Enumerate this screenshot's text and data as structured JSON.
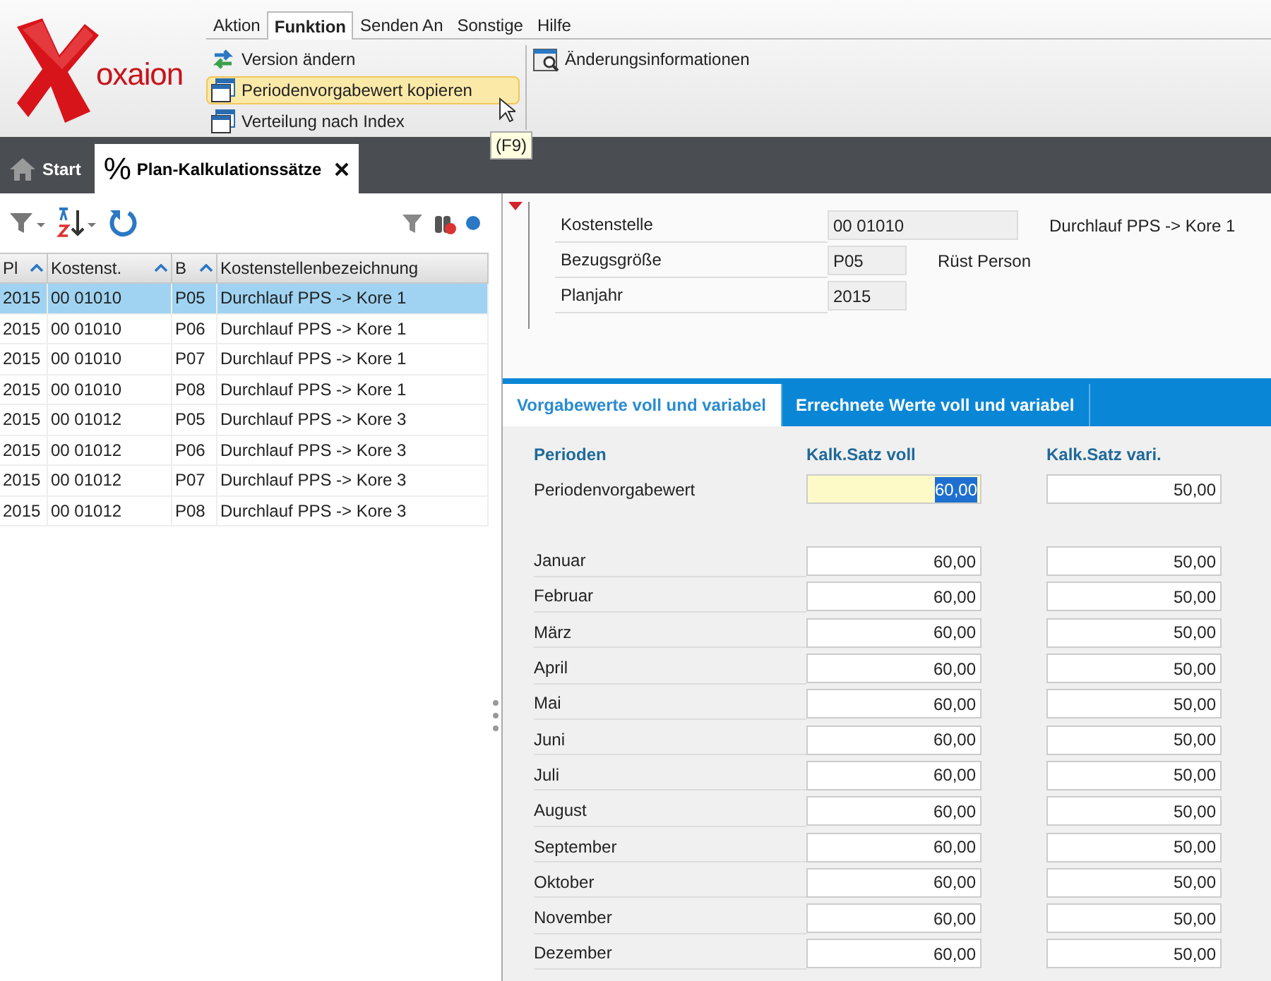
{
  "logo": {
    "text": "oxaion"
  },
  "menu": [
    {
      "label": "Aktion",
      "selected": false
    },
    {
      "label": "Funktion",
      "selected": true
    },
    {
      "label": "Senden An",
      "selected": false
    },
    {
      "label": "Sonstige",
      "selected": false
    },
    {
      "label": "Hilfe",
      "selected": false
    }
  ],
  "ribbon": [
    {
      "label": "Version ändern",
      "kind": "swap",
      "hovered": false
    },
    {
      "label": "Periodenvorgabewert kopieren",
      "kind": "window",
      "hovered": true
    },
    {
      "label": "Verteilung nach Index",
      "kind": "window",
      "hovered": false
    }
  ],
  "ribbon_right": [
    {
      "label": "Änderungsinformationen",
      "kind": "calendar"
    }
  ],
  "tooltip": "(F9)",
  "doc_tabs": [
    {
      "label": "Start",
      "kind": "home",
      "selected": false
    },
    {
      "label": "Plan-Kalkulationssätze",
      "kind": "symbol",
      "symbol": "%",
      "selected": true
    }
  ],
  "table": {
    "columns": [
      "Pl",
      "Kostenst.",
      "B",
      "Kostenstellenbezeichnung"
    ],
    "rows": [
      {
        "cells": [
          "2015",
          "00 01010",
          "P05",
          "Durchlauf PPS -> Kore 1"
        ],
        "selected": true
      },
      {
        "cells": [
          "2015",
          "00 01010",
          "P06",
          "Durchlauf PPS -> Kore 1"
        ],
        "selected": false
      },
      {
        "cells": [
          "2015",
          "00 01010",
          "P07",
          "Durchlauf PPS -> Kore 1"
        ],
        "selected": false
      },
      {
        "cells": [
          "2015",
          "00 01010",
          "P08",
          "Durchlauf PPS -> Kore 1"
        ],
        "selected": false
      },
      {
        "cells": [
          "2015",
          "00 01012",
          "P05",
          "Durchlauf PPS -> Kore 3"
        ],
        "selected": false
      },
      {
        "cells": [
          "2015",
          "00 01012",
          "P06",
          "Durchlauf PPS -> Kore 3"
        ],
        "selected": false
      },
      {
        "cells": [
          "2015",
          "00 01012",
          "P07",
          "Durchlauf PPS -> Kore 3"
        ],
        "selected": false
      },
      {
        "cells": [
          "2015",
          "00 01012",
          "P08",
          "Durchlauf PPS -> Kore 3"
        ],
        "selected": false
      }
    ]
  },
  "header_fields": [
    {
      "label": "Kostenstelle",
      "value": "00 01010",
      "note": "Durchlauf PPS -> Kore 1",
      "kind": "wide"
    },
    {
      "label": "Bezugsgröße",
      "value": "P05",
      "note": "Rüst Person",
      "kind": "small"
    },
    {
      "label": "Planjahr",
      "value": "2015",
      "kind": "small"
    }
  ],
  "detail_tabs": [
    {
      "label": "Vorgabewerte voll und variabel",
      "selected": true
    },
    {
      "label": "Errechnete Werte voll und variabel",
      "selected": false
    }
  ],
  "grid": {
    "columns": [
      "Perioden",
      "Kalk.Satz voll",
      "Kalk.Satz vari."
    ],
    "default_row": {
      "label": "Periodenvorgabewert",
      "voll": "60,00",
      "vari": "50,00",
      "focused": true
    },
    "months": [
      {
        "label": "Januar",
        "voll": "60,00",
        "vari": "50,00"
      },
      {
        "label": "Februar",
        "voll": "60,00",
        "vari": "50,00"
      },
      {
        "label": "März",
        "voll": "60,00",
        "vari": "50,00"
      },
      {
        "label": "April",
        "voll": "60,00",
        "vari": "50,00"
      },
      {
        "label": "Mai",
        "voll": "60,00",
        "vari": "50,00"
      },
      {
        "label": "Juni",
        "voll": "60,00",
        "vari": "50,00"
      },
      {
        "label": "Juli",
        "voll": "60,00",
        "vari": "50,00"
      },
      {
        "label": "August",
        "voll": "60,00",
        "vari": "50,00"
      },
      {
        "label": "September",
        "voll": "60,00",
        "vari": "50,00"
      },
      {
        "label": "Oktober",
        "voll": "60,00",
        "vari": "50,00"
      },
      {
        "label": "November",
        "voll": "60,00",
        "vari": "50,00"
      },
      {
        "label": "Dezember",
        "voll": "60,00",
        "vari": "50,00"
      }
    ]
  }
}
